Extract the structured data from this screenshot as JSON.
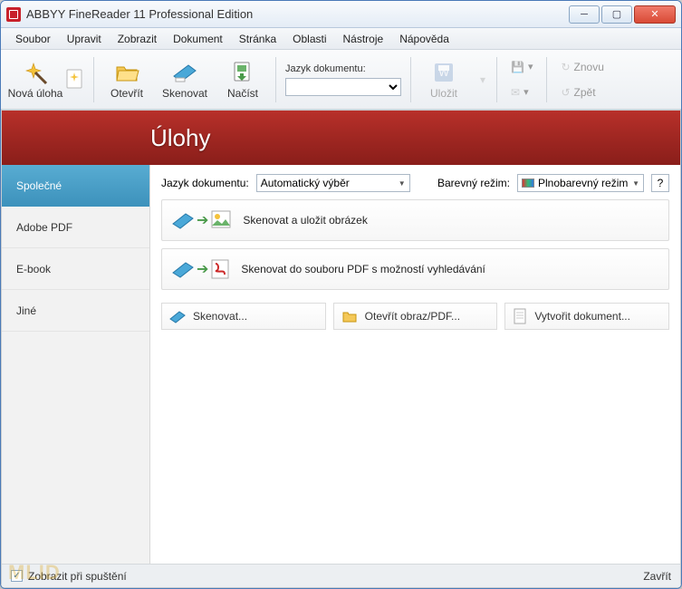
{
  "title": "ABBYY FineReader 11 Professional Edition",
  "menu": [
    "Soubor",
    "Upravit",
    "Zobrazit",
    "Dokument",
    "Stránka",
    "Oblasti",
    "Nástroje",
    "Nápověda"
  ],
  "toolbar": {
    "new_task": "Nová úloha",
    "open": "Otevřít",
    "scan": "Skenovat",
    "load": "Načíst",
    "lang_label": "Jazyk dokumentu:",
    "lang_value": "",
    "save": "Uložit",
    "redo": "Znovu",
    "back": "Zpět"
  },
  "header": "Úlohy",
  "sidebar": {
    "items": [
      {
        "label": "Společné"
      },
      {
        "label": "Adobe PDF"
      },
      {
        "label": "E-book"
      },
      {
        "label": "Jiné"
      }
    ]
  },
  "panel": {
    "lang_label": "Jazyk dokumentu:",
    "lang_value": "Automatický výběr",
    "color_label": "Barevný režim:",
    "color_value": "Plnobarevný režim",
    "help": "?",
    "task1": "Skenovat a uložit obrázek",
    "task2": "Skenovat do souboru PDF s možností vyhledávání",
    "action1": "Skenovat...",
    "action2": "Otevřít obraz/PDF...",
    "action3": "Vytvořit dokument..."
  },
  "footer": {
    "show_label": "Zobrazit při spuštění",
    "close": "Zavřít"
  }
}
